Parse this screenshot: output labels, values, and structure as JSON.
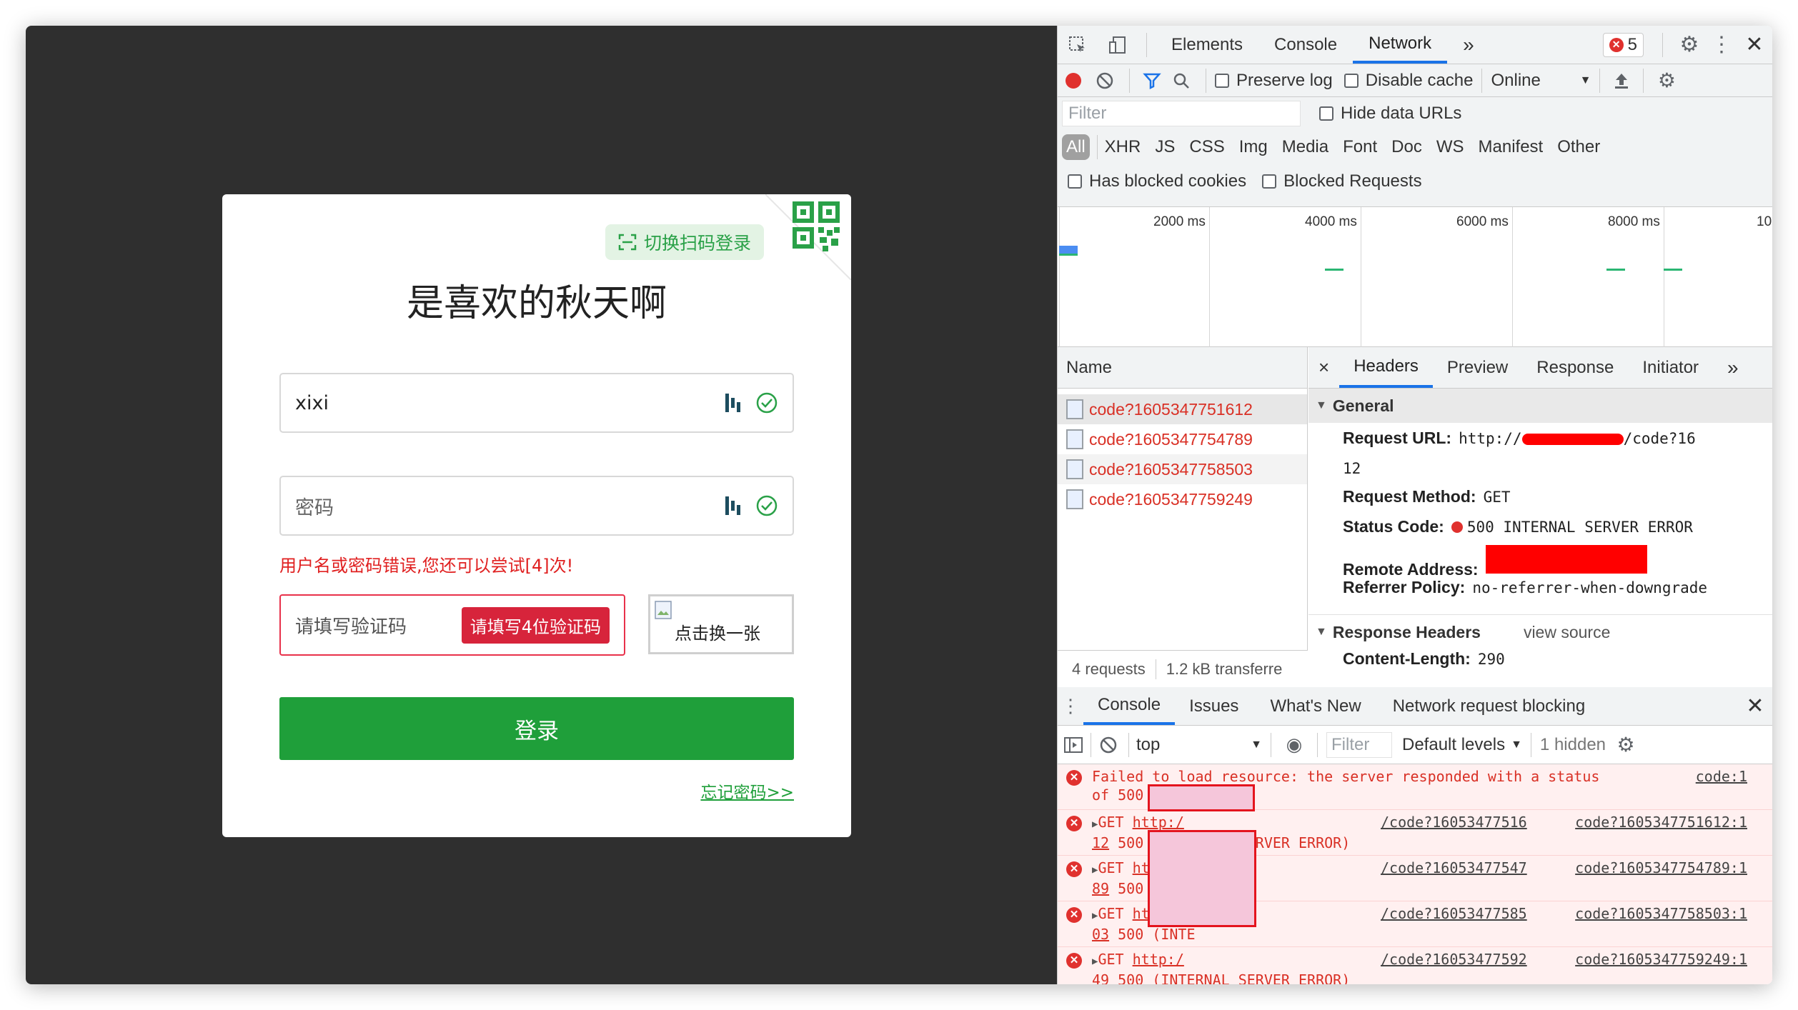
{
  "login": {
    "switch_label": "切换扫码登录",
    "title": "是喜欢的秋天啊",
    "username_value": "xixi",
    "password_placeholder": "密码",
    "error_message": "用户名或密码错误,您还可以尝试[4]次!",
    "captcha_placeholder": "请填写验证码",
    "captcha_tip": "请填写4位验证码",
    "captcha_image_alt": "点击换一张",
    "login_button": "登录",
    "forgot_link": "忘记密码>>",
    "accent_color": "#1f9f3a",
    "error_color": "#e02020"
  },
  "devtools": {
    "tabs": [
      "Elements",
      "Console",
      "Network"
    ],
    "active_tab": "Network",
    "more_tabs": "»",
    "error_count": "5",
    "toolbar": {
      "preserve_log": "Preserve log",
      "disable_cache": "Disable cache",
      "throttle": "Online"
    },
    "filter": {
      "placeholder": "Filter",
      "hide_data_urls": "Hide data URLs",
      "types": [
        "All",
        "XHR",
        "JS",
        "CSS",
        "Img",
        "Media",
        "Font",
        "Doc",
        "WS",
        "Manifest",
        "Other"
      ],
      "has_blocked_cookies": "Has blocked cookies",
      "blocked_requests": "Blocked Requests"
    },
    "timeline_labels": [
      "2000 ms",
      "4000 ms",
      "6000 ms",
      "8000 ms",
      "10"
    ],
    "requests": {
      "header": "Name",
      "rows": [
        "code?1605347751612",
        "code?1605347754789",
        "code?1605347758503",
        "code?1605347759249"
      ],
      "summary_count": "4 requests",
      "summary_size": "1.2 kB transferre"
    },
    "headers_panel": {
      "close": "×",
      "tabs": [
        "Headers",
        "Preview",
        "Response",
        "Initiator"
      ],
      "more": "»",
      "general_title": "General",
      "request_url_key": "Request URL:",
      "request_url_prefix": "http://",
      "request_url_suffix": "/code?16",
      "request_url_wrap": "12",
      "request_method_key": "Request Method:",
      "request_method": "GET",
      "status_code_key": "Status Code:",
      "status_code": "500 INTERNAL SERVER ERROR",
      "remote_address_key": "Remote Address:",
      "referrer_policy_key": "Referrer Policy:",
      "referrer_policy": "no-referrer-when-downgrade",
      "response_headers_title": "Response Headers",
      "view_source": "view source",
      "content_length_key": "Content-Length:",
      "content_length": "290"
    },
    "drawer": {
      "tabs": [
        "Console",
        "Issues",
        "What's New",
        "Network request blocking"
      ],
      "context": "top",
      "filter_placeholder": "Filter",
      "levels": "Default levels",
      "hidden": "1 hidden"
    },
    "console": {
      "first_line_1": "Failed to load resource: the server responded with a status",
      "first_line_2": "of 500 (INTE",
      "first_source": "code:1",
      "entries": [
        {
          "prefix": "GET ",
          "http": "http:/",
          "url": "/code?16053477516",
          "source": "code?1605347751612:1",
          "wrap_u": "12",
          "wrap_rest": " 500 (INTERNAL SERVER ERROR)"
        },
        {
          "prefix": "GET ",
          "http": "http:/",
          "url": "/code?16053477547",
          "source": "code?1605347754789:1",
          "wrap_u": "89",
          "wrap_rest": " 500 (INTE"
        },
        {
          "prefix": "GET ",
          "http": "http:/",
          "url": "/code?16053477585",
          "source": "code?1605347758503:1",
          "wrap_u": "03",
          "wrap_rest": " 500 (INTE"
        },
        {
          "prefix": "GET ",
          "http": "http:/",
          "url": "/code?16053477592",
          "source": "code?1605347759249:1",
          "wrap_u": "49",
          "wrap_rest": " 500 (INTERNAL SERVER ERROR)"
        }
      ]
    }
  }
}
